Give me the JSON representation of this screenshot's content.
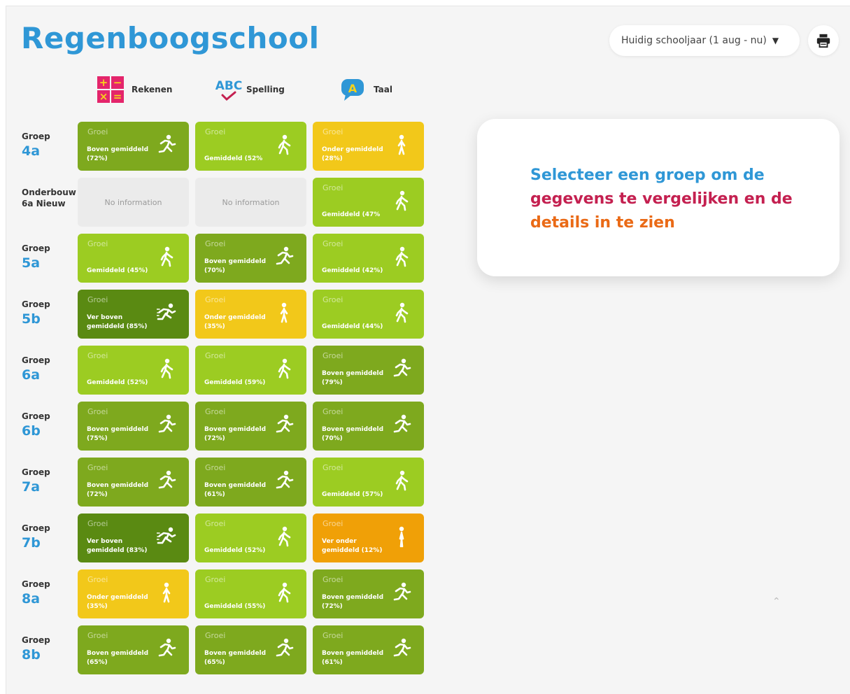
{
  "school_name": "Regenboogschool",
  "year_select": {
    "value": "Huidig schooljaar (1 aug - nu)"
  },
  "subjects": [
    {
      "label": "Rekenen",
      "icon": "math-operations-icon"
    },
    {
      "label": "Spelling",
      "icon": "abc-spelling-icon"
    },
    {
      "label": "Taal",
      "icon": "speech-bubble-a-icon"
    }
  ],
  "colors": {
    "ver_boven": "#5a8a12",
    "boven": "#7ea91e",
    "gemiddeld": "#9ccc22",
    "onder": "#f2c81a",
    "ver_onder": "#f0a007",
    "no_info": "#ebebeb",
    "accent_blue": "#2f97d6",
    "accent_crimson": "#c42050",
    "accent_orange": "#ea6a16"
  },
  "rows": [
    {
      "small": "Groep",
      "big": "4a",
      "cells": [
        {
          "level": "boven",
          "groei": "Groei",
          "text": "Boven gemiddeld (72%)"
        },
        {
          "level": "gemiddeld",
          "groei": "Groei",
          "text": "Gemiddeld (52%"
        },
        {
          "level": "onder",
          "groei": "Groei",
          "text": "Onder gemiddeld (28%)"
        }
      ]
    },
    {
      "small": "Onderbouw",
      "big": "6a Nieuw",
      "big_small": true,
      "cells": [
        {
          "level": "na",
          "text": "No information"
        },
        {
          "level": "na",
          "text": "No information"
        },
        {
          "level": "gemiddeld",
          "groei": "Groei",
          "text": "Gemiddeld (47%"
        }
      ]
    },
    {
      "small": "Groep",
      "big": "5a",
      "cells": [
        {
          "level": "gemiddeld",
          "groei": "Groei",
          "text": "Gemiddeld (45%)"
        },
        {
          "level": "boven",
          "groei": "Groei",
          "text": "Boven gemiddeld (70%)"
        },
        {
          "level": "gemiddeld",
          "groei": "Groei",
          "text": "Gemiddeld (42%)"
        }
      ]
    },
    {
      "small": "Groep",
      "big": "5b",
      "cells": [
        {
          "level": "ver_boven",
          "groei": "Groei",
          "text": "Ver boven gemiddeld (85%)"
        },
        {
          "level": "onder",
          "groei": "Groei",
          "text": "Onder gemiddeld (35%)"
        },
        {
          "level": "gemiddeld",
          "groei": "Groei",
          "text": "Gemiddeld (44%)"
        }
      ]
    },
    {
      "small": "Groep",
      "big": "6a",
      "cells": [
        {
          "level": "gemiddeld",
          "groei": "Groei",
          "text": "Gemiddeld (52%)"
        },
        {
          "level": "gemiddeld",
          "groei": "Groei",
          "text": "Gemiddeld (59%)"
        },
        {
          "level": "boven",
          "groei": "Groei",
          "text": "Boven gemiddeld (79%)"
        }
      ]
    },
    {
      "small": "Groep",
      "big": "6b",
      "cells": [
        {
          "level": "boven",
          "groei": "Groei",
          "text": "Boven gemiddeld (75%)"
        },
        {
          "level": "boven",
          "groei": "Groei",
          "text": "Boven gemiddeld (72%)"
        },
        {
          "level": "boven",
          "groei": "Groei",
          "text": "Boven gemiddeld (70%)"
        }
      ]
    },
    {
      "small": "Groep",
      "big": "7a",
      "cells": [
        {
          "level": "boven",
          "groei": "Groei",
          "text": "Boven gemiddeld (72%)"
        },
        {
          "level": "boven",
          "groei": "Groei",
          "text": "Boven gemiddeld (61%)"
        },
        {
          "level": "gemiddeld",
          "groei": "Groei",
          "text": "Gemiddeld (57%)"
        }
      ]
    },
    {
      "small": "Groep",
      "big": "7b",
      "cells": [
        {
          "level": "ver_boven",
          "groei": "Groei",
          "text": "Ver boven gemiddeld (83%)"
        },
        {
          "level": "gemiddeld",
          "groei": "Groei",
          "text": "Gemiddeld (52%)"
        },
        {
          "level": "ver_onder",
          "groei": "Groei",
          "text": "Ver onder gemiddeld (12%)"
        }
      ]
    },
    {
      "small": "Groep",
      "big": "8a",
      "cells": [
        {
          "level": "onder",
          "groei": "Groei",
          "text": "Onder gemiddeld (35%)"
        },
        {
          "level": "gemiddeld",
          "groei": "Groei",
          "text": "Gemiddeld (55%)"
        },
        {
          "level": "boven",
          "groei": "Groei",
          "text": "Boven gemiddeld (72%)"
        }
      ]
    },
    {
      "small": "Groep",
      "big": "8b",
      "cells": [
        {
          "level": "boven",
          "groei": "Groei",
          "text": "Boven gemiddeld (65%)"
        },
        {
          "level": "boven",
          "groei": "Groei",
          "text": "Boven gemiddeld (65%)"
        },
        {
          "level": "boven",
          "groei": "Groei",
          "text": "Boven gemiddeld (61%)"
        }
      ]
    }
  ],
  "info": {
    "line1": "Selecteer een groep om de",
    "line2": "gegevens te vergelijken en de",
    "line3": "details in te zien"
  }
}
